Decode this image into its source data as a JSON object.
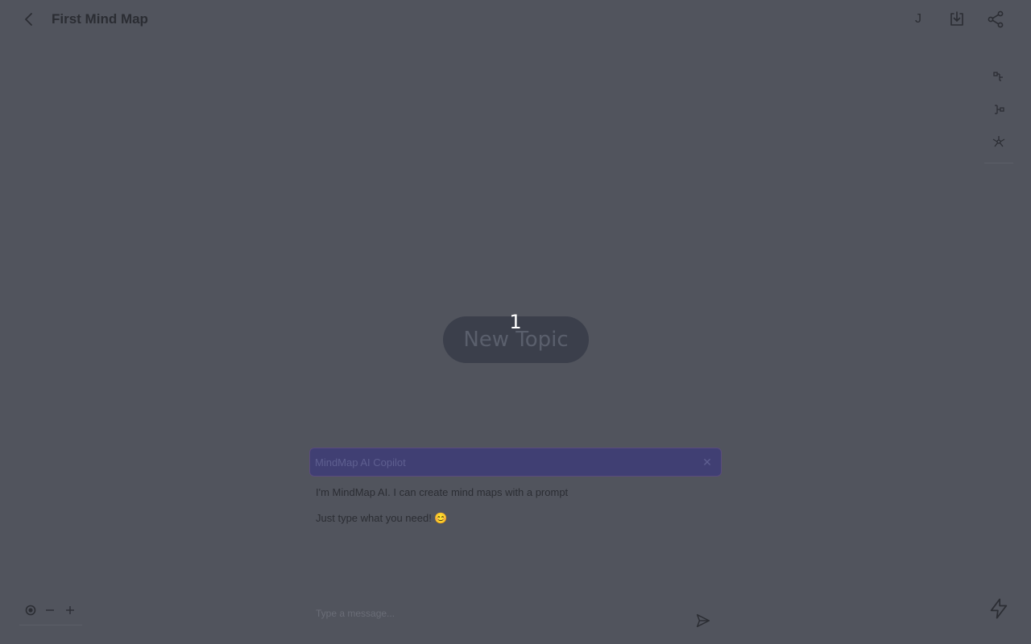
{
  "header": {
    "title": "First Mind Map",
    "avatar_initial": "J",
    "icons": {
      "back": "chevron-left-icon",
      "download": "download-icon",
      "share": "share-icon"
    }
  },
  "layout_panel": {
    "icons": [
      "layout-right-icon",
      "layout-left-icon",
      "layout-radial-icon"
    ]
  },
  "canvas": {
    "node": {
      "label": "New Topic",
      "badge": "1"
    }
  },
  "copilot": {
    "title": "MindMap AI Copilot",
    "messages": [
      "I'm MindMap AI. I can create mind maps with a prompt",
      "Just type what you need! 😊"
    ],
    "input_placeholder": "Type a message...",
    "close_icon": "close-icon",
    "send_icon": "send-icon"
  },
  "zoom": {
    "icons": [
      "fit-view-icon",
      "zoom-out-icon",
      "zoom-in-icon"
    ]
  },
  "ai_button_icon": "lightning-icon",
  "colors": {
    "background": "#51545d",
    "node": "#3b3f4b",
    "copilot_header": "#403f73",
    "text": "#2b2d33"
  }
}
